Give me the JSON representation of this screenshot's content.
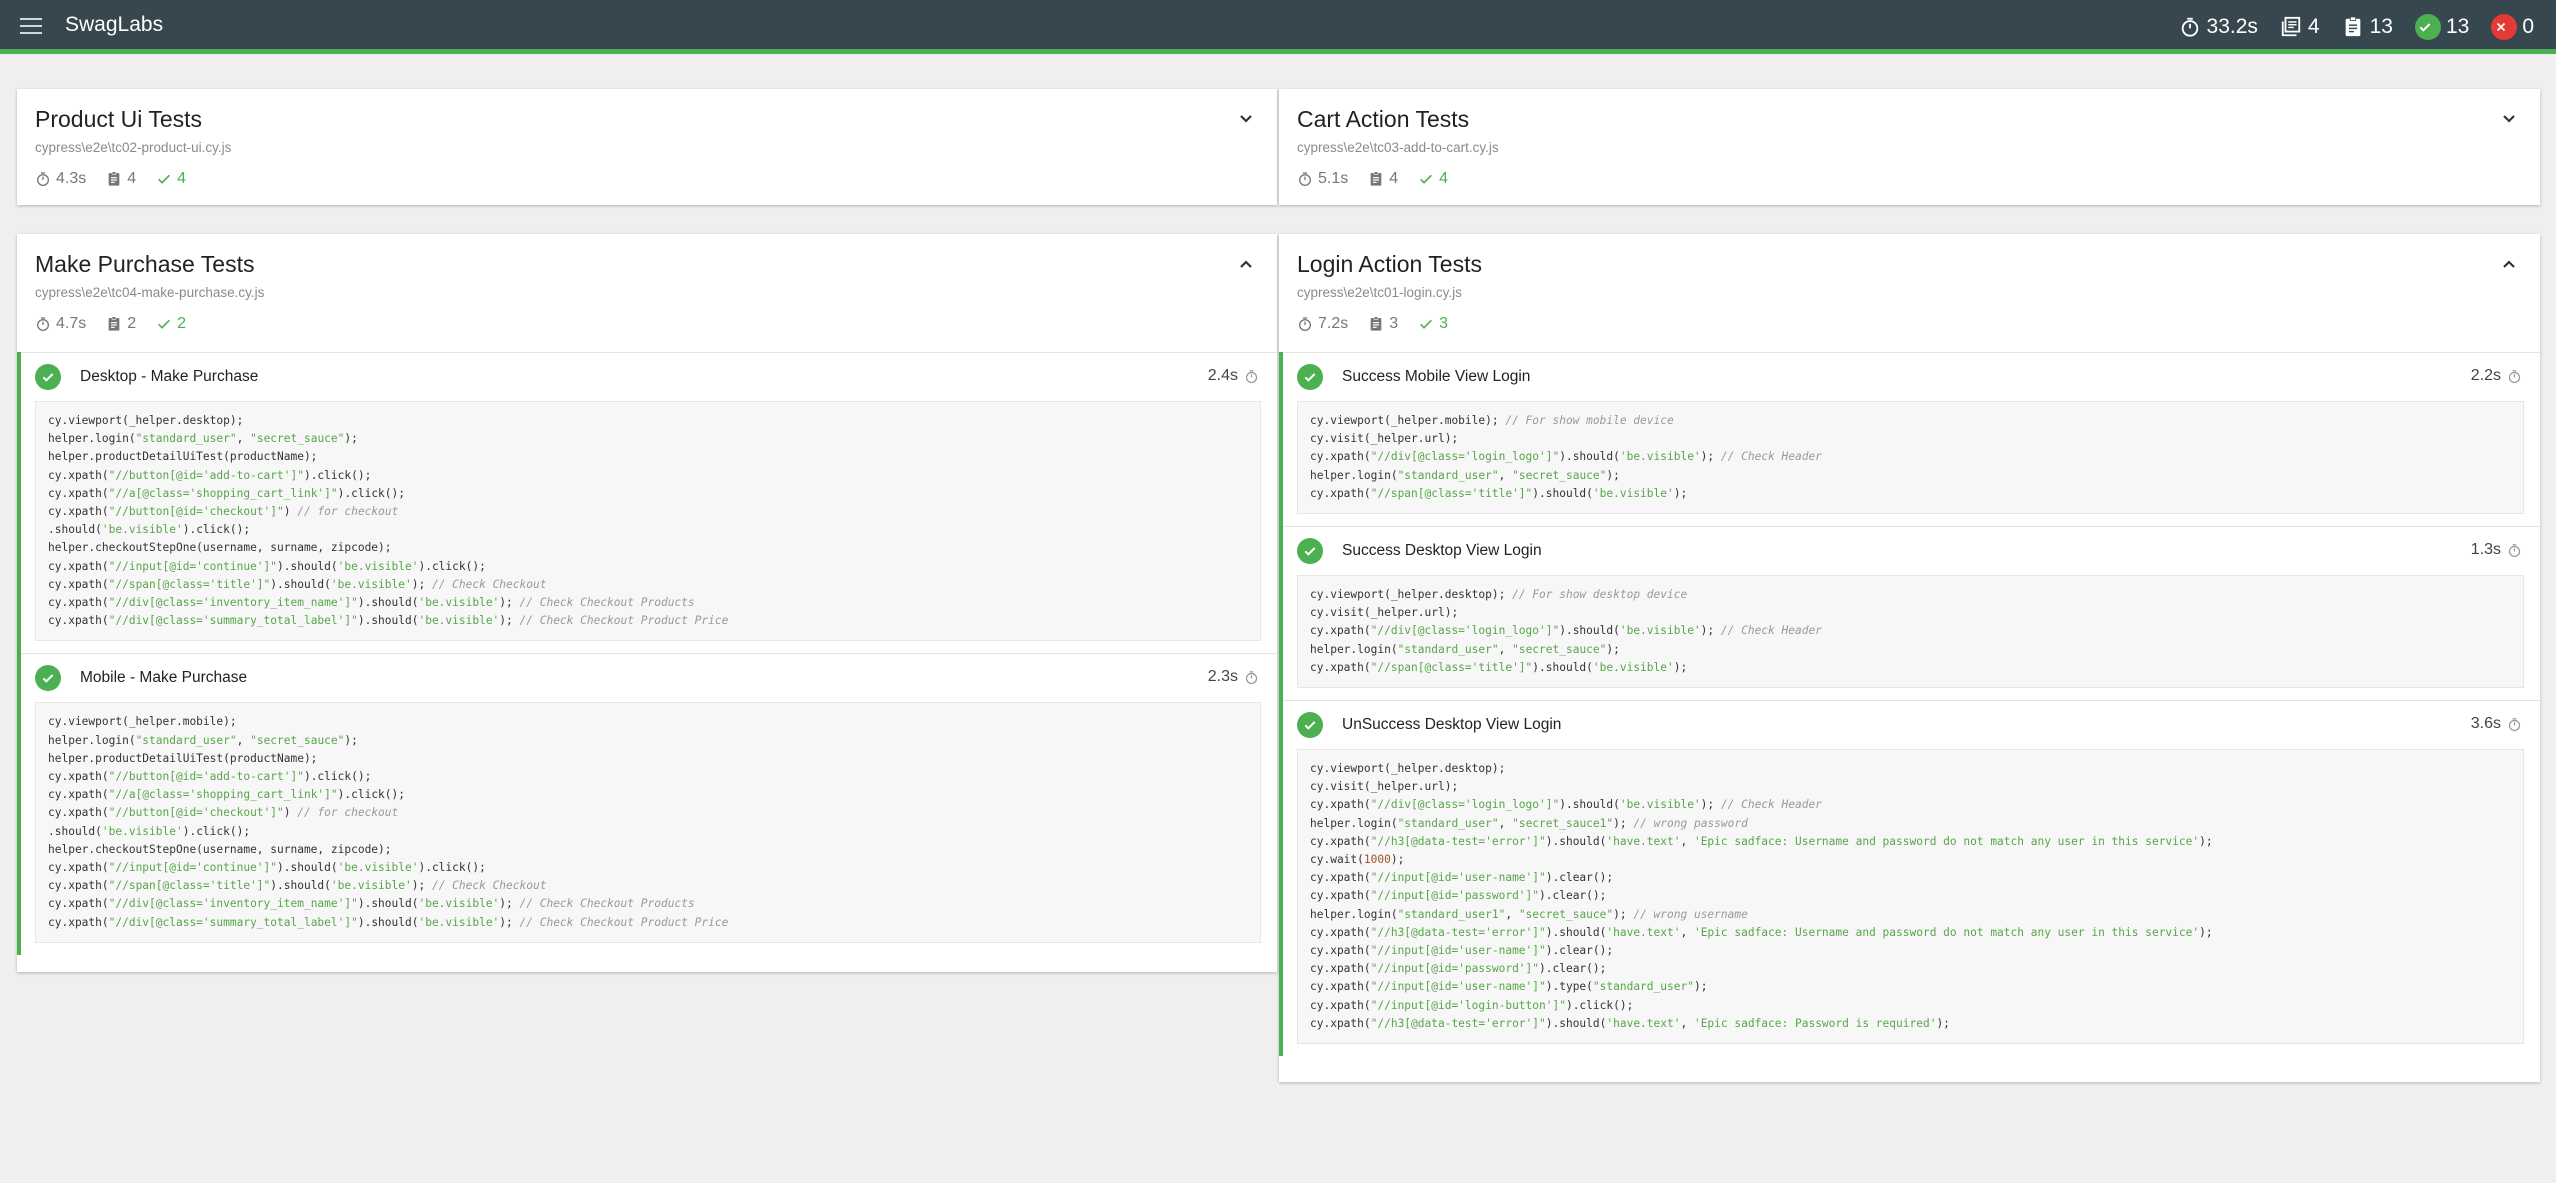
{
  "app": {
    "brand": "SwagLabs",
    "stats": {
      "duration": "33.2s",
      "suites": "4",
      "tests": "13",
      "passes": "13",
      "failures": "0"
    }
  },
  "colors": {
    "topbar": "#37474f",
    "pass": "#4caf50",
    "fail": "#e53935",
    "background": "#efefef"
  },
  "suites": [
    {
      "title": "Product Ui Tests",
      "file": "cypress\\e2e\\tc02-product-ui.cy.js",
      "duration": "4.3s",
      "tests": "4",
      "passes": "4",
      "expanded": false,
      "chevron": "chevron-down-icon",
      "testcases": []
    },
    {
      "title": "Cart Action Tests",
      "file": "cypress\\e2e\\tc03-add-to-cart.cy.js",
      "duration": "5.1s",
      "tests": "4",
      "passes": "4",
      "expanded": false,
      "chevron": "chevron-down-icon",
      "testcases": []
    },
    {
      "title": "Make Purchase Tests",
      "file": "cypress\\e2e\\tc04-make-purchase.cy.js",
      "duration": "4.7s",
      "tests": "2",
      "passes": "2",
      "expanded": true,
      "chevron": "chevron-up-icon",
      "testcases": [
        {
          "title": "Desktop - Make Purchase",
          "duration": "2.4s",
          "code": [
            "cy.viewport(_helper.desktop);",
            "helper.login(\"standard_user\", \"secret_sauce\");",
            "helper.productDetailUiTest(productName);",
            "cy.xpath(\"//button[@id='add-to-cart']\").click();",
            "cy.xpath(\"//a[@class='shopping_cart_link']\").click();",
            "cy.xpath(\"//button[@id='checkout']\") // for checkout",
            ".should('be.visible').click();",
            "helper.checkoutStepOne(username, surname, zipcode);",
            "cy.xpath(\"//input[@id='continue']\").should('be.visible').click();",
            "cy.xpath(\"//span[@class='title']\").should('be.visible'); // Check Checkout",
            "cy.xpath(\"//div[@class='inventory_item_name']\").should('be.visible'); // Check Checkout Products",
            "cy.xpath(\"//div[@class='summary_total_label']\").should('be.visible'); // Check Checkout Product Price"
          ]
        },
        {
          "title": "Mobile - Make Purchase",
          "duration": "2.3s",
          "code": [
            "cy.viewport(_helper.mobile);",
            "helper.login(\"standard_user\", \"secret_sauce\");",
            "helper.productDetailUiTest(productName);",
            "cy.xpath(\"//button[@id='add-to-cart']\").click();",
            "cy.xpath(\"//a[@class='shopping_cart_link']\").click();",
            "cy.xpath(\"//button[@id='checkout']\") // for checkout",
            ".should('be.visible').click();",
            "helper.checkoutStepOne(username, surname, zipcode);",
            "cy.xpath(\"//input[@id='continue']\").should('be.visible').click();",
            "cy.xpath(\"//span[@class='title']\").should('be.visible'); // Check Checkout",
            "cy.xpath(\"//div[@class='inventory_item_name']\").should('be.visible'); // Check Checkout Products",
            "cy.xpath(\"//div[@class='summary_total_label']\").should('be.visible'); // Check Checkout Product Price"
          ]
        }
      ]
    },
    {
      "title": "Login Action Tests",
      "file": "cypress\\e2e\\tc01-login.cy.js",
      "duration": "7.2s",
      "tests": "3",
      "passes": "3",
      "expanded": true,
      "chevron": "chevron-up-icon",
      "testcases": [
        {
          "title": "Success Mobile View Login",
          "duration": "2.2s",
          "code": [
            "cy.viewport(_helper.mobile); // For show mobile device",
            "cy.visit(_helper.url);",
            "cy.xpath(\"//div[@class='login_logo']\").should('be.visible'); // Check Header",
            "helper.login(\"standard_user\", \"secret_sauce\");",
            "cy.xpath(\"//span[@class='title']\").should('be.visible');"
          ]
        },
        {
          "title": "Success Desktop View Login",
          "duration": "1.3s",
          "code": [
            "cy.viewport(_helper.desktop); // For show desktop device",
            "cy.visit(_helper.url);",
            "cy.xpath(\"//div[@class='login_logo']\").should('be.visible'); // Check Header",
            "helper.login(\"standard_user\", \"secret_sauce\");",
            "cy.xpath(\"//span[@class='title']\").should('be.visible');"
          ]
        },
        {
          "title": "UnSuccess Desktop View Login",
          "duration": "3.6s",
          "code": [
            "cy.viewport(_helper.desktop);",
            "cy.visit(_helper.url);",
            "cy.xpath(\"//div[@class='login_logo']\").should('be.visible'); // Check Header",
            "helper.login(\"standard_user\", \"secret_sauce1\"); // wrong password",
            "cy.xpath(\"//h3[@data-test='error']\").should('have.text', 'Epic sadface: Username and password do not match any user in this service');",
            "cy.wait(1000);",
            "cy.xpath(\"//input[@id='user-name']\").clear();",
            "cy.xpath(\"//input[@id='password']\").clear();",
            "helper.login(\"standard_user1\", \"secret_sauce\"); // wrong username",
            "cy.xpath(\"//h3[@data-test='error']\").should('have.text', 'Epic sadface: Username and password do not match any user in this service');",
            "cy.xpath(\"//input[@id='user-name']\").clear();",
            "cy.xpath(\"//input[@id='password']\").clear();",
            "cy.xpath(\"//input[@id='user-name']\").type(\"standard_user\");",
            "cy.xpath(\"//input[@id='login-button']\").click();",
            "cy.xpath(\"//h3[@data-test='error']\").should('have.text', 'Epic sadface: Password is required');"
          ]
        }
      ]
    }
  ]
}
